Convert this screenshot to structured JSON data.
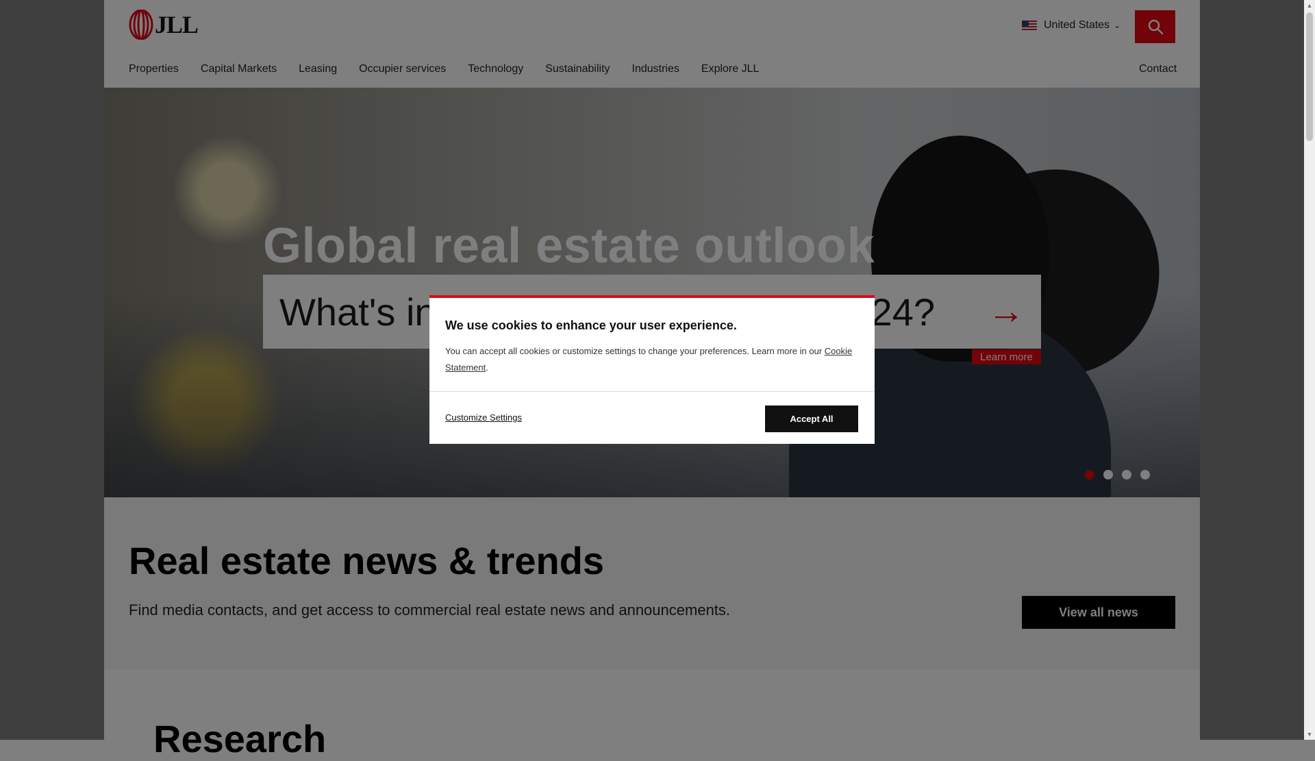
{
  "header": {
    "logo_text": "JLL",
    "region_label": "United States",
    "search_icon": "search-icon",
    "nav": [
      "Properties",
      "Capital Markets",
      "Leasing",
      "Occupier services",
      "Technology",
      "Sustainability",
      "Industries",
      "Explore JLL"
    ],
    "contact_label": "Contact"
  },
  "hero": {
    "title": "Global real estate outlook",
    "subtitle": "What's in store for real estate in 2024?",
    "learn_more": "Learn more",
    "slide_count": 4,
    "active_slide": 1
  },
  "news": {
    "title": "Real estate news & trends",
    "description": "Find media contacts, and get access to commercial real estate news and announcements.",
    "button_label": "View all news"
  },
  "below": {
    "partial_heading": "Research"
  },
  "cookie_modal": {
    "title": "We use cookies to enhance your user experience.",
    "body_text": "You can accept all cookies or customize settings to change your preferences. Learn more in our ",
    "link_text": "Cookie Statement",
    "body_end": ".",
    "customize_label": "Customize Settings",
    "accept_label": "Accept All"
  },
  "colors": {
    "brand_red": "#e30613",
    "overlay": "rgba(0,0,0,0.5)"
  }
}
